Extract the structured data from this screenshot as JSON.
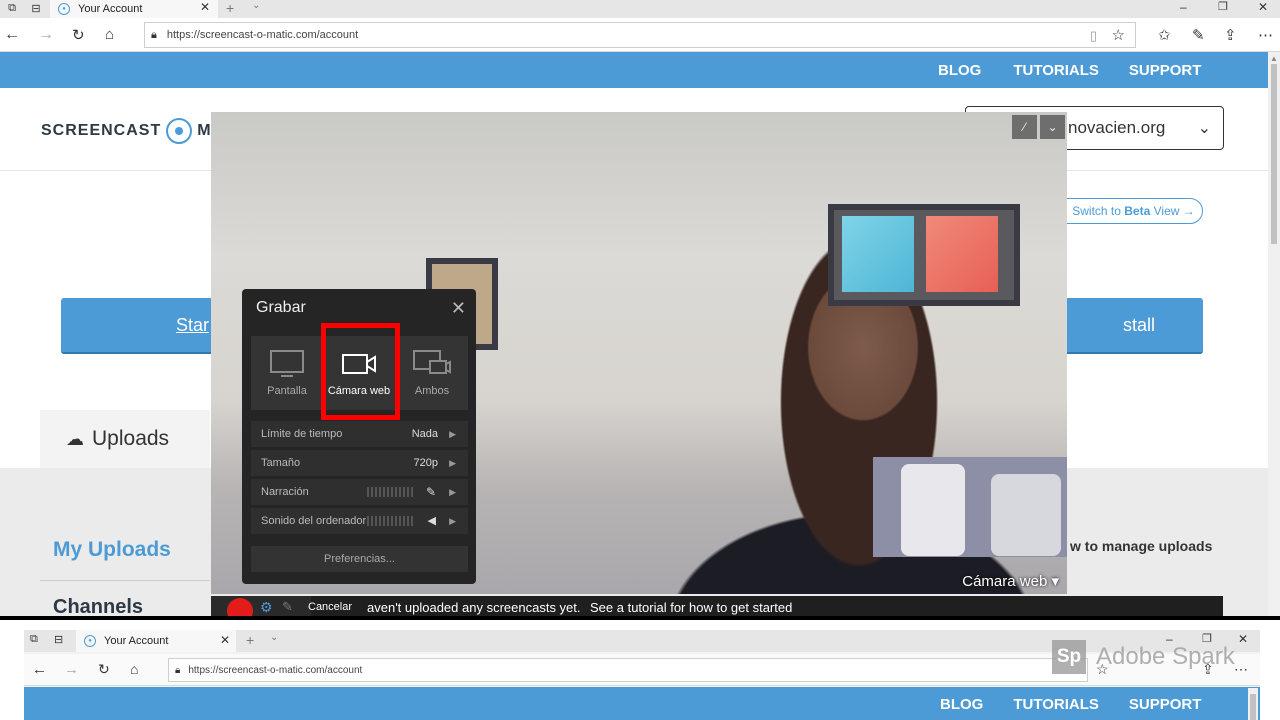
{
  "browser_top": {
    "tab_title": "Your Account",
    "url": "https://screencast-o-matic.com/account",
    "window_buttons": [
      "–",
      "❐",
      "✕"
    ]
  },
  "site": {
    "nav": {
      "blog": "BLOG",
      "tutorials": "TUTORIALS",
      "support": "SUPPORT"
    },
    "logo_left": "SCREENCAST",
    "logo_right": "MA",
    "account_email_partial": "novacien.org",
    "beta_prefix": "Switch to ",
    "beta_strong": "Beta",
    "beta_suffix": " View →",
    "start_link_partial": "Star",
    "install_partial": "stall",
    "uploads_tab": "Uploads",
    "my_uploads": "My Uploads",
    "channels": "Channels",
    "manage_uploads_partial": "w to manage uploads",
    "no_uploads_partial": "aven't uploaded any screencasts yet.",
    "tutorial_text": "See a tutorial for how to get started"
  },
  "recorder": {
    "title": "Grabar",
    "modes": [
      {
        "label": "Pantalla",
        "icon": "monitor-icon",
        "selected": false
      },
      {
        "label": "Cámara web",
        "icon": "video-camera-icon",
        "selected": true
      },
      {
        "label": "Ambos",
        "icon": "screen-and-camera-icon",
        "selected": false
      }
    ],
    "settings": [
      {
        "label": "Límite de tiempo",
        "value": "Nada"
      },
      {
        "label": "Tamaño",
        "value": "720p"
      },
      {
        "label": "Narración",
        "value": ""
      },
      {
        "label": "Sonido del ordenador",
        "value": ""
      }
    ],
    "preferences": "Preferencias...",
    "camera_label": "Cámara web",
    "cancel": "Cancelar"
  },
  "browser_bottom": {
    "tab_title": "Your Account",
    "url": "https://screencast-o-matic.com/account"
  },
  "watermark": {
    "logo": "Sp",
    "text": "Adobe Spark"
  },
  "colors": {
    "brand_blue": "#4d9bd6",
    "record_red": "#e31b1b",
    "highlight_red": "#ff0000"
  }
}
